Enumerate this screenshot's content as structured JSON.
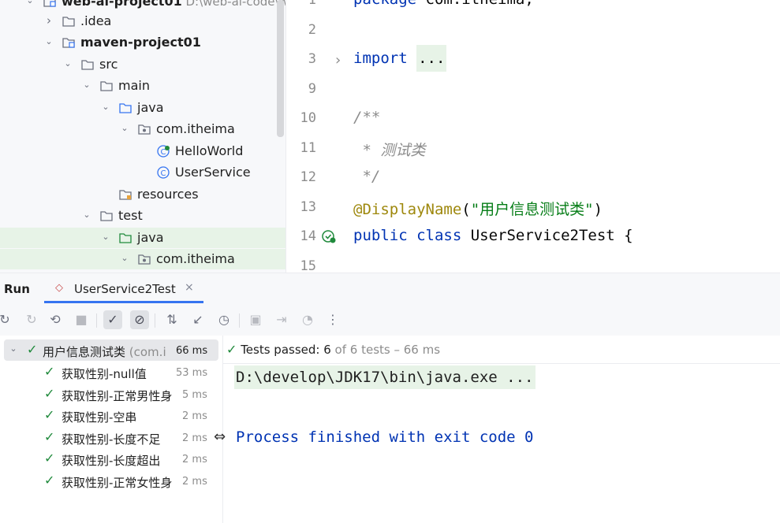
{
  "project_tree": {
    "rows": [
      {
        "label": "web-ai-project01",
        "path": "D:\\web-ai-code\\web-",
        "bold": true,
        "icon": "module-icon",
        "chevron": "down"
      },
      {
        "label": ".idea",
        "icon": "folder-icon",
        "chevron": "right"
      },
      {
        "label": "maven-project01",
        "bold": true,
        "icon": "module-icon",
        "chevron": "down"
      },
      {
        "label": "src",
        "icon": "folder-icon",
        "chevron": "down"
      },
      {
        "label": "main",
        "icon": "folder-icon",
        "chevron": "down"
      },
      {
        "label": "java",
        "icon": "source-folder-icon",
        "chevron": "down"
      },
      {
        "label": "com.itheima",
        "icon": "package-icon",
        "chevron": "down"
      },
      {
        "label": "HelloWorld",
        "icon": "class-run-icon",
        "chevron": ""
      },
      {
        "label": "UserService",
        "icon": "class-icon",
        "chevron": ""
      },
      {
        "label": "resources",
        "icon": "resources-folder-icon",
        "chevron": ""
      },
      {
        "label": "test",
        "icon": "folder-icon",
        "chevron": "down"
      },
      {
        "label": "java",
        "icon": "test-folder-icon",
        "chevron": "down"
      },
      {
        "label": "com.itheima",
        "icon": "package-icon",
        "chevron": "down"
      }
    ]
  },
  "editor": {
    "lines": [
      {
        "num": "1",
        "parts": [
          {
            "t": "package ",
            "c": "kw"
          },
          {
            "t": "com.itheima;",
            "c": ""
          }
        ]
      },
      {
        "num": "2",
        "parts": []
      },
      {
        "num": "3",
        "parts": [
          {
            "t": "import ",
            "c": "kw"
          },
          {
            "t": "...",
            "c": "fold"
          }
        ]
      },
      {
        "num": "9",
        "parts": []
      },
      {
        "num": "10",
        "parts": [
          {
            "t": "/**",
            "c": "cm"
          }
        ]
      },
      {
        "num": "11",
        "parts": [
          {
            "t": " * 测试类",
            "c": "cm"
          }
        ]
      },
      {
        "num": "12",
        "parts": [
          {
            "t": " */",
            "c": "cm"
          }
        ]
      },
      {
        "num": "13",
        "parts": [
          {
            "t": "@DisplayName",
            "c": "an"
          },
          {
            "t": "(",
            "c": ""
          },
          {
            "t": "\"用户信息测试类\"",
            "c": "st"
          },
          {
            "t": ")",
            "c": ""
          }
        ]
      },
      {
        "num": "14",
        "parts": [
          {
            "t": "public class ",
            "c": "kw"
          },
          {
            "t": "UserService2Test {",
            "c": ""
          }
        ]
      },
      {
        "num": "15",
        "parts": []
      }
    ]
  },
  "run_panel": {
    "title": "Run",
    "tab_label": "UserService2Test",
    "tab_close": "×"
  },
  "results": {
    "root": {
      "label": "用户信息测试类",
      "sub": "(com.i",
      "time": "66 ms"
    },
    "tests": [
      {
        "label": "获取性别-null值",
        "time": "53 ms"
      },
      {
        "label": "获取性别-正常男性身",
        "time": "5 ms"
      },
      {
        "label": "获取性别-空串",
        "time": "2 ms"
      },
      {
        "label": "获取性别-长度不足",
        "time": "2 ms"
      },
      {
        "label": "获取性别-长度超出",
        "time": "2 ms"
      },
      {
        "label": "获取性别-正常女性身",
        "time": "2 ms"
      }
    ]
  },
  "console": {
    "status_passed": "Tests passed: 6",
    "status_rest": " of 6 tests – 66 ms",
    "command": "D:\\develop\\JDK17\\bin\\java.exe ...",
    "exit_message": "Process finished with exit code 0"
  },
  "colors": {
    "accent": "#3574f0",
    "pass": "#208a3c",
    "selection_green": "#e7f3e7"
  }
}
